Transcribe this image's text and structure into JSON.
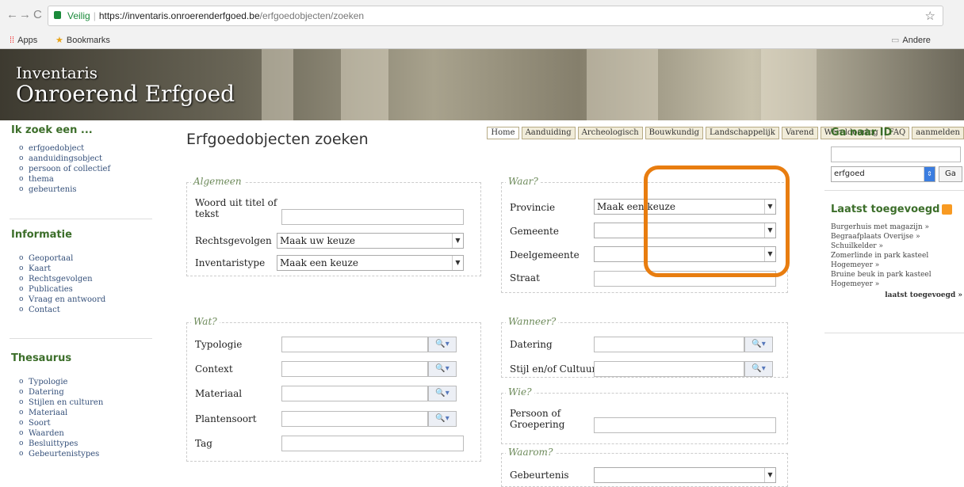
{
  "browser": {
    "secure_label": "Veilig",
    "url_host": "https://inventaris.onroerenderfgoed.be",
    "url_path": "/erfgoedobjecten/zoeken",
    "bookmarks": [
      {
        "label": "Apps"
      },
      {
        "label": "Bookmarks"
      },
      {
        "label": "Andere bladwijzers"
      }
    ]
  },
  "site": {
    "title_line1": "Inventaris",
    "title_line2": "Onroerend Erfgoed",
    "nav": [
      "Home",
      "Aanduiding",
      "Archeologisch",
      "Bouwkundig",
      "Landschappelijk",
      "Varend",
      "Wereldoorlog",
      "FAQ",
      "aanmelden"
    ]
  },
  "left": {
    "search_heading": "Ik zoek een ...",
    "search_items": [
      "erfgoedobject",
      "aanduidingsobject",
      "persoon of collectief",
      "thema",
      "gebeurtenis"
    ],
    "info_heading": "Informatie",
    "info_items": [
      "Geoportaal",
      "Kaart",
      "Rechtsgevolgen",
      "Publicaties",
      "Vraag en antwoord",
      "Contact"
    ],
    "thes_heading": "Thesaurus",
    "thes_items": [
      "Typologie",
      "Datering",
      "Stijlen en culturen",
      "Materiaal",
      "Soort",
      "Waarden",
      "Besluittypes",
      "Gebeurtenistypes"
    ]
  },
  "main": {
    "title": "Erfgoedobjecten zoeken",
    "algemeen": {
      "legend": "Algemeen",
      "woord_label": "Woord uit titel of tekst",
      "rechts_label": "Rechtsgevolgen",
      "rechts_value": "Maak uw keuze",
      "type_label": "Inventaristype",
      "type_value": "Maak een keuze"
    },
    "waar": {
      "legend": "Waar?",
      "provincie_label": "Provincie",
      "provincie_value": "Maak een keuze",
      "gemeente_label": "Gemeente",
      "deelgemeente_label": "Deelgemeente",
      "straat_label": "Straat"
    },
    "wat": {
      "legend": "Wat?",
      "typologie_label": "Typologie",
      "context_label": "Context",
      "materiaal_label": "Materiaal",
      "plantensoort_label": "Plantensoort",
      "tag_label": "Tag"
    },
    "wanneer": {
      "legend": "Wanneer?",
      "datering_label": "Datering",
      "stijl_label": "Stijl en/of Cultuur"
    },
    "wie": {
      "legend": "Wie?",
      "persoon_label": "Persoon of Groepering"
    },
    "waarom": {
      "legend": "Waarom?",
      "gebeurtenis_label": "Gebeurtenis"
    }
  },
  "right": {
    "ganaar_heading": "Ga naar ID",
    "ganaar_select": "erfgoed",
    "ganaar_button": "Ga",
    "recent_heading": "Laatst toegevoegd",
    "recent_items": [
      "Burgerhuis met magazijn",
      "Begraafplaats Overijse",
      "Schuilkelder",
      "Zomerlinde in park kasteel Hogemeyer",
      "Bruine beuk in park kasteel Hogemeyer"
    ],
    "recent_more": "laatst toegevoegd"
  },
  "colors": {
    "highlight": "#e87d10",
    "heading_green": "#3c6e2a"
  }
}
